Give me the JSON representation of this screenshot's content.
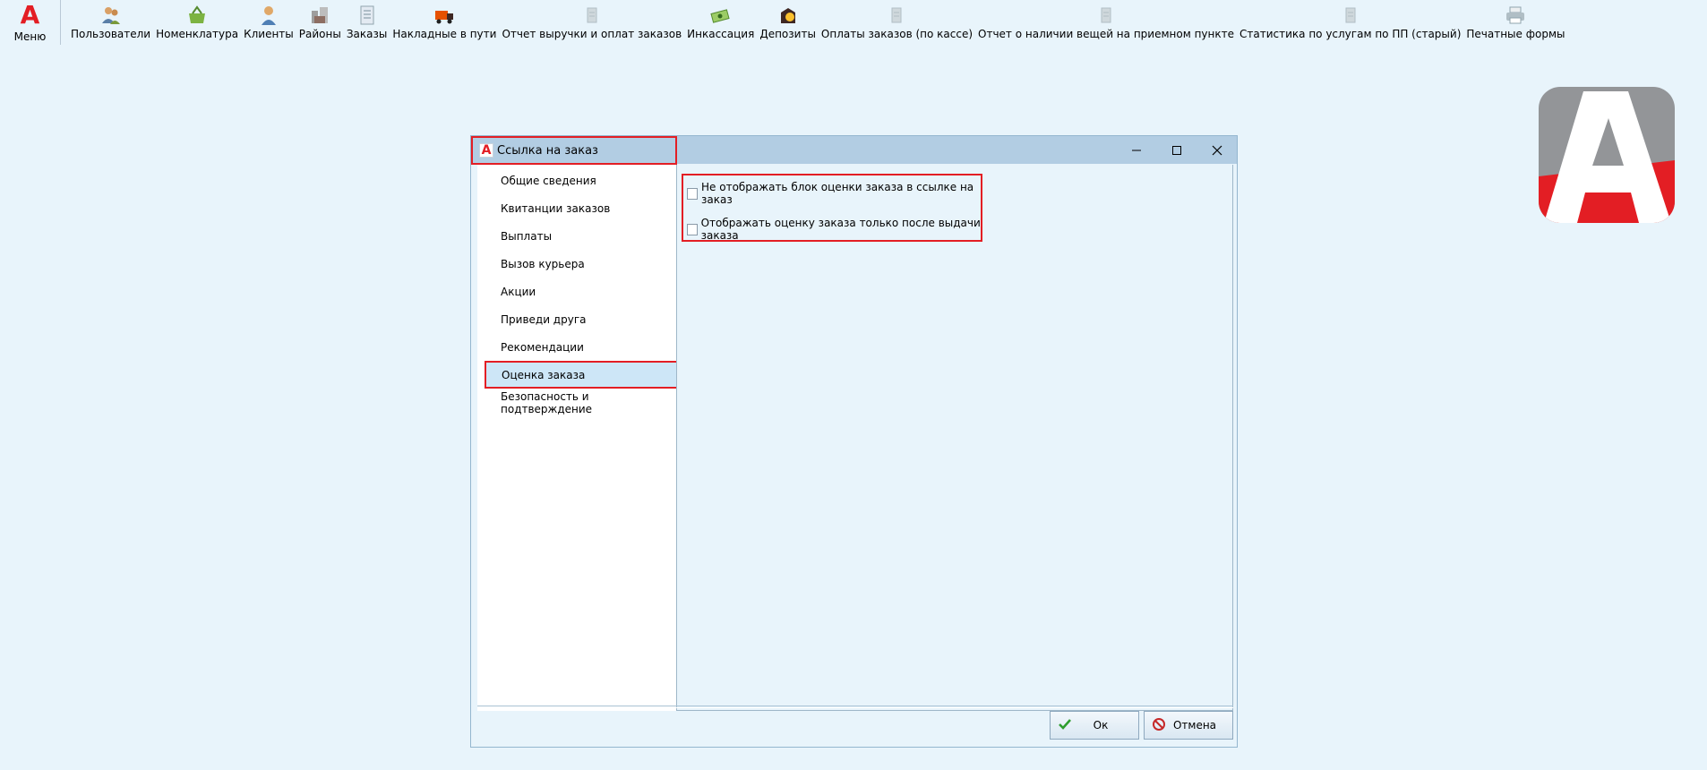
{
  "toolbar": {
    "menu_label": "Меню",
    "menu_logo": "А",
    "items": [
      {
        "label": "Пользователи",
        "icon": "users-icon"
      },
      {
        "label": "Номенклатура",
        "icon": "basket-icon"
      },
      {
        "label": "Клиенты",
        "icon": "client-icon"
      },
      {
        "label": "Районы",
        "icon": "districts-icon"
      },
      {
        "label": "Заказы",
        "icon": "orders-icon"
      },
      {
        "label": "Накладные в пути",
        "icon": "truck-icon"
      },
      {
        "label": "Отчет выручки и оплат заказов",
        "icon": "report-icon"
      },
      {
        "label": "Инкассация",
        "icon": "money-icon"
      },
      {
        "label": "Депозиты",
        "icon": "deposit-icon"
      },
      {
        "label": "Оплаты заказов (по кассе)",
        "icon": "report-icon"
      },
      {
        "label": "Отчет о наличии вещей на приемном пункте",
        "icon": "report-icon"
      },
      {
        "label": "Статистика по услугам по ПП (старый)",
        "icon": "report-icon"
      },
      {
        "label": "Печатные формы",
        "icon": "printer-icon"
      }
    ]
  },
  "dialog": {
    "title": "Ссылка на заказ",
    "title_icon": "А",
    "nav": [
      {
        "label": "Общие сведения",
        "selected": false
      },
      {
        "label": "Квитанции заказов",
        "selected": false
      },
      {
        "label": "Выплаты",
        "selected": false
      },
      {
        "label": "Вызов курьера",
        "selected": false
      },
      {
        "label": "Акции",
        "selected": false
      },
      {
        "label": "Приведи друга",
        "selected": false
      },
      {
        "label": "Рекомендации",
        "selected": false
      },
      {
        "label": "Оценка заказа",
        "selected": true
      },
      {
        "label": "Безопасность и подтверждение",
        "selected": false
      }
    ],
    "options": [
      {
        "label": "Не отображать блок оценки заказа в ссылке на заказ",
        "checked": false
      },
      {
        "label": "Отображать оценку заказа только после выдачи заказа",
        "checked": false
      }
    ],
    "ok_label": "Ок",
    "cancel_label": "Отмена"
  },
  "colors": {
    "background": "#e8f4fb",
    "titlebar": "#b2cde3",
    "accent_red": "#e31e24",
    "selected_item": "#cde6f7"
  }
}
